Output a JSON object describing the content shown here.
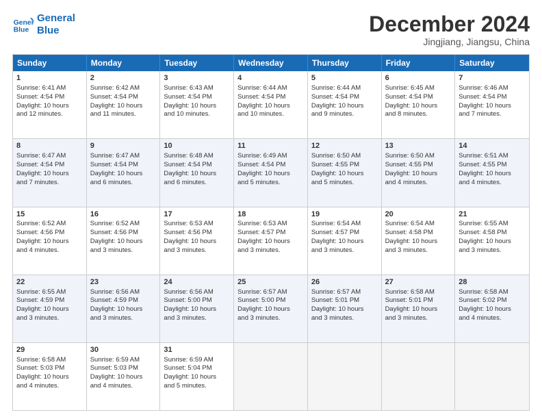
{
  "logo": {
    "line1": "General",
    "line2": "Blue"
  },
  "title": "December 2024",
  "location": "Jingjiang, Jiangsu, China",
  "weekdays": [
    "Sunday",
    "Monday",
    "Tuesday",
    "Wednesday",
    "Thursday",
    "Friday",
    "Saturday"
  ],
  "rows": [
    [
      {
        "day": "1",
        "lines": [
          "Sunrise: 6:41 AM",
          "Sunset: 4:54 PM",
          "Daylight: 10 hours",
          "and 12 minutes."
        ]
      },
      {
        "day": "2",
        "lines": [
          "Sunrise: 6:42 AM",
          "Sunset: 4:54 PM",
          "Daylight: 10 hours",
          "and 11 minutes."
        ]
      },
      {
        "day": "3",
        "lines": [
          "Sunrise: 6:43 AM",
          "Sunset: 4:54 PM",
          "Daylight: 10 hours",
          "and 10 minutes."
        ]
      },
      {
        "day": "4",
        "lines": [
          "Sunrise: 6:44 AM",
          "Sunset: 4:54 PM",
          "Daylight: 10 hours",
          "and 10 minutes."
        ]
      },
      {
        "day": "5",
        "lines": [
          "Sunrise: 6:44 AM",
          "Sunset: 4:54 PM",
          "Daylight: 10 hours",
          "and 9 minutes."
        ]
      },
      {
        "day": "6",
        "lines": [
          "Sunrise: 6:45 AM",
          "Sunset: 4:54 PM",
          "Daylight: 10 hours",
          "and 8 minutes."
        ]
      },
      {
        "day": "7",
        "lines": [
          "Sunrise: 6:46 AM",
          "Sunset: 4:54 PM",
          "Daylight: 10 hours",
          "and 7 minutes."
        ]
      }
    ],
    [
      {
        "day": "8",
        "lines": [
          "Sunrise: 6:47 AM",
          "Sunset: 4:54 PM",
          "Daylight: 10 hours",
          "and 7 minutes."
        ]
      },
      {
        "day": "9",
        "lines": [
          "Sunrise: 6:47 AM",
          "Sunset: 4:54 PM",
          "Daylight: 10 hours",
          "and 6 minutes."
        ]
      },
      {
        "day": "10",
        "lines": [
          "Sunrise: 6:48 AM",
          "Sunset: 4:54 PM",
          "Daylight: 10 hours",
          "and 6 minutes."
        ]
      },
      {
        "day": "11",
        "lines": [
          "Sunrise: 6:49 AM",
          "Sunset: 4:54 PM",
          "Daylight: 10 hours",
          "and 5 minutes."
        ]
      },
      {
        "day": "12",
        "lines": [
          "Sunrise: 6:50 AM",
          "Sunset: 4:55 PM",
          "Daylight: 10 hours",
          "and 5 minutes."
        ]
      },
      {
        "day": "13",
        "lines": [
          "Sunrise: 6:50 AM",
          "Sunset: 4:55 PM",
          "Daylight: 10 hours",
          "and 4 minutes."
        ]
      },
      {
        "day": "14",
        "lines": [
          "Sunrise: 6:51 AM",
          "Sunset: 4:55 PM",
          "Daylight: 10 hours",
          "and 4 minutes."
        ]
      }
    ],
    [
      {
        "day": "15",
        "lines": [
          "Sunrise: 6:52 AM",
          "Sunset: 4:56 PM",
          "Daylight: 10 hours",
          "and 4 minutes."
        ]
      },
      {
        "day": "16",
        "lines": [
          "Sunrise: 6:52 AM",
          "Sunset: 4:56 PM",
          "Daylight: 10 hours",
          "and 3 minutes."
        ]
      },
      {
        "day": "17",
        "lines": [
          "Sunrise: 6:53 AM",
          "Sunset: 4:56 PM",
          "Daylight: 10 hours",
          "and 3 minutes."
        ]
      },
      {
        "day": "18",
        "lines": [
          "Sunrise: 6:53 AM",
          "Sunset: 4:57 PM",
          "Daylight: 10 hours",
          "and 3 minutes."
        ]
      },
      {
        "day": "19",
        "lines": [
          "Sunrise: 6:54 AM",
          "Sunset: 4:57 PM",
          "Daylight: 10 hours",
          "and 3 minutes."
        ]
      },
      {
        "day": "20",
        "lines": [
          "Sunrise: 6:54 AM",
          "Sunset: 4:58 PM",
          "Daylight: 10 hours",
          "and 3 minutes."
        ]
      },
      {
        "day": "21",
        "lines": [
          "Sunrise: 6:55 AM",
          "Sunset: 4:58 PM",
          "Daylight: 10 hours",
          "and 3 minutes."
        ]
      }
    ],
    [
      {
        "day": "22",
        "lines": [
          "Sunrise: 6:55 AM",
          "Sunset: 4:59 PM",
          "Daylight: 10 hours",
          "and 3 minutes."
        ]
      },
      {
        "day": "23",
        "lines": [
          "Sunrise: 6:56 AM",
          "Sunset: 4:59 PM",
          "Daylight: 10 hours",
          "and 3 minutes."
        ]
      },
      {
        "day": "24",
        "lines": [
          "Sunrise: 6:56 AM",
          "Sunset: 5:00 PM",
          "Daylight: 10 hours",
          "and 3 minutes."
        ]
      },
      {
        "day": "25",
        "lines": [
          "Sunrise: 6:57 AM",
          "Sunset: 5:00 PM",
          "Daylight: 10 hours",
          "and 3 minutes."
        ]
      },
      {
        "day": "26",
        "lines": [
          "Sunrise: 6:57 AM",
          "Sunset: 5:01 PM",
          "Daylight: 10 hours",
          "and 3 minutes."
        ]
      },
      {
        "day": "27",
        "lines": [
          "Sunrise: 6:58 AM",
          "Sunset: 5:01 PM",
          "Daylight: 10 hours",
          "and 3 minutes."
        ]
      },
      {
        "day": "28",
        "lines": [
          "Sunrise: 6:58 AM",
          "Sunset: 5:02 PM",
          "Daylight: 10 hours",
          "and 4 minutes."
        ]
      }
    ],
    [
      {
        "day": "29",
        "lines": [
          "Sunrise: 6:58 AM",
          "Sunset: 5:03 PM",
          "Daylight: 10 hours",
          "and 4 minutes."
        ]
      },
      {
        "day": "30",
        "lines": [
          "Sunrise: 6:59 AM",
          "Sunset: 5:03 PM",
          "Daylight: 10 hours",
          "and 4 minutes."
        ]
      },
      {
        "day": "31",
        "lines": [
          "Sunrise: 6:59 AM",
          "Sunset: 5:04 PM",
          "Daylight: 10 hours",
          "and 5 minutes."
        ]
      },
      {
        "day": "",
        "lines": []
      },
      {
        "day": "",
        "lines": []
      },
      {
        "day": "",
        "lines": []
      },
      {
        "day": "",
        "lines": []
      }
    ]
  ]
}
